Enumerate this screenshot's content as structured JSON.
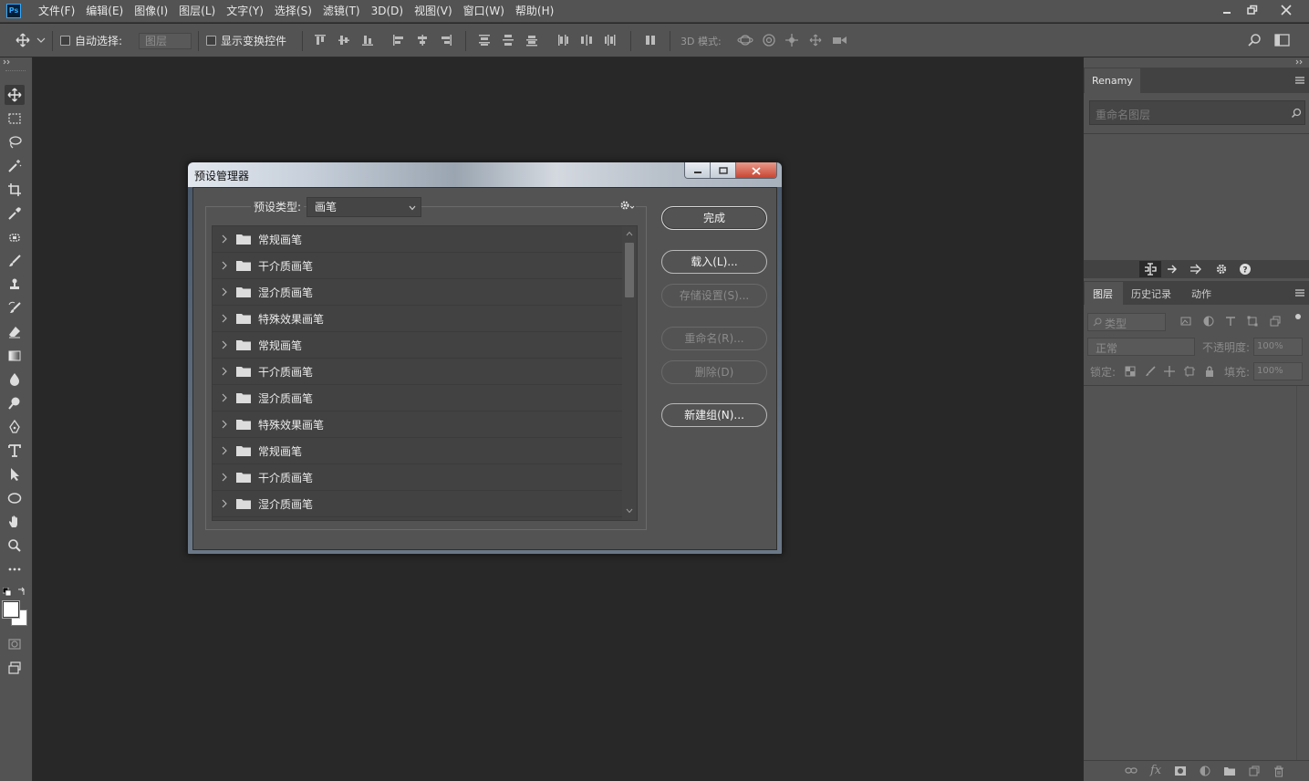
{
  "app": {
    "logo_text": "Ps"
  },
  "menu": [
    "文件(F)",
    "编辑(E)",
    "图像(I)",
    "图层(L)",
    "文字(Y)",
    "选择(S)",
    "滤镜(T)",
    "3D(D)",
    "视图(V)",
    "窗口(W)",
    "帮助(H)"
  ],
  "options_bar": {
    "auto_select_label": "自动选择:",
    "auto_select_target": "图层",
    "show_transform_label": "显示变换控件",
    "mode_3d_label": "3D 模式:"
  },
  "renamy_panel": {
    "tab": "Renamy",
    "search_placeholder": "重命名图层"
  },
  "layers_panel": {
    "tabs": [
      "图层",
      "历史记录",
      "动作"
    ],
    "filter_placeholder": "类型",
    "blend_mode": "正常",
    "opacity_label": "不透明度:",
    "opacity_value": "100%",
    "lock_label": "锁定:",
    "fill_label": "填充:",
    "fill_value": "100%"
  },
  "dialog": {
    "title": "预设管理器",
    "preset_type_label": "预设类型:",
    "preset_type_value": "画笔",
    "items": [
      "常规画笔",
      "干介质画笔",
      "湿介质画笔",
      "特殊效果画笔",
      "常规画笔",
      "干介质画笔",
      "湿介质画笔",
      "特殊效果画笔",
      "常规画笔",
      "干介质画笔",
      "湿介质画笔"
    ],
    "buttons": {
      "done": "完成",
      "load": "载入(L)...",
      "save": "存储设置(S)...",
      "rename": "重命名(R)...",
      "delete": "删除(D)",
      "new_group": "新建组(N)..."
    }
  },
  "colors": {
    "ui_bg": "#535353",
    "canvas_bg": "#282828",
    "list_bg": "#424242"
  }
}
